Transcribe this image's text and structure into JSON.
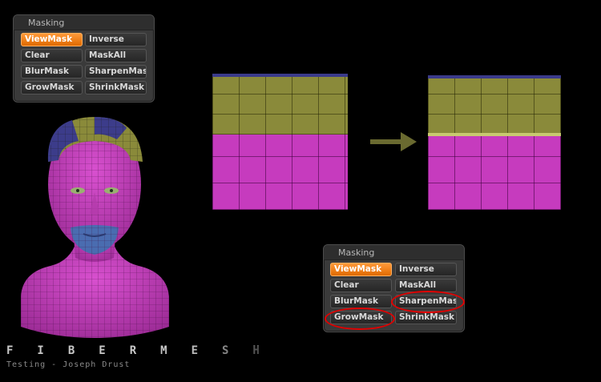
{
  "masking_panel": {
    "title": "Masking",
    "buttons": {
      "view_mask": "ViewMask",
      "inverse": "Inverse",
      "clear": "Clear",
      "mask_all": "MaskAll",
      "blur_mask": "BlurMask",
      "sharpen_mask": "SharpenMask",
      "grow_mask": "GrowMask",
      "shrink_mask": "ShrinkMask"
    }
  },
  "footer": {
    "brand": "FIBERMESH",
    "credit": "Testing - Joseph Drust"
  },
  "colors": {
    "active_button": "#f07a10",
    "mask_magenta": "#c63bbe",
    "mask_olive": "#8a8a3a",
    "mask_blue": "#4a6cb0",
    "arrow": "#6a6a30",
    "annotation": "#e00000"
  }
}
